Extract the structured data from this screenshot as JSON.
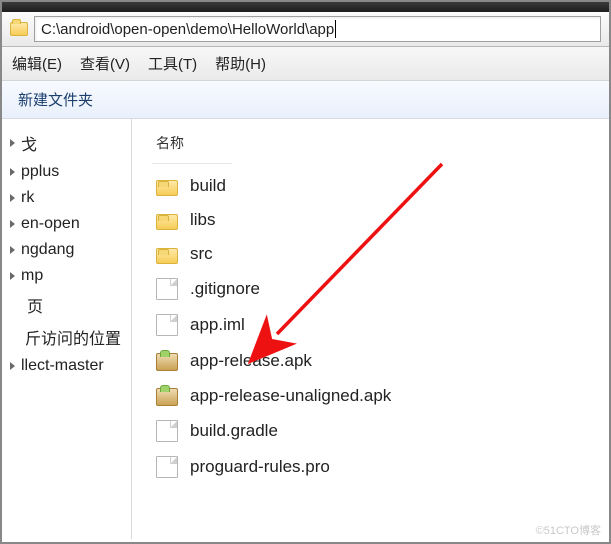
{
  "address": {
    "path": "C:\\android\\open-open\\demo\\HelloWorld\\app"
  },
  "menu": {
    "edit": "编辑(E)",
    "view": "查看(V)",
    "tools": "工具(T)",
    "help": "帮助(H)"
  },
  "toolbar": {
    "new_folder": "新建文件夹"
  },
  "columns": {
    "name": "名称"
  },
  "nav": {
    "items": [
      {
        "label": "戈",
        "expandable": true
      },
      {
        "label": "pplus",
        "expandable": true
      },
      {
        "label": "rk",
        "expandable": true
      },
      {
        "label": "en-open",
        "expandable": true
      },
      {
        "label": "ngdang",
        "expandable": true
      },
      {
        "label": "mp",
        "expandable": true
      },
      {
        "label": "页",
        "expandable": false
      },
      {
        "label": "斤访问的位置",
        "expandable": false
      },
      {
        "label": "llect-master",
        "expandable": true
      }
    ]
  },
  "files": [
    {
      "icon": "folder",
      "name": "build"
    },
    {
      "icon": "folder",
      "name": "libs"
    },
    {
      "icon": "folder",
      "name": "src"
    },
    {
      "icon": "file",
      "name": ".gitignore"
    },
    {
      "icon": "file",
      "name": "app.iml"
    },
    {
      "icon": "apk",
      "name": "app-release.apk"
    },
    {
      "icon": "apk",
      "name": "app-release-unaligned.apk"
    },
    {
      "icon": "file",
      "name": "build.gradle"
    },
    {
      "icon": "file",
      "name": "proguard-rules.pro"
    }
  ],
  "watermark": "©51CTO博客"
}
